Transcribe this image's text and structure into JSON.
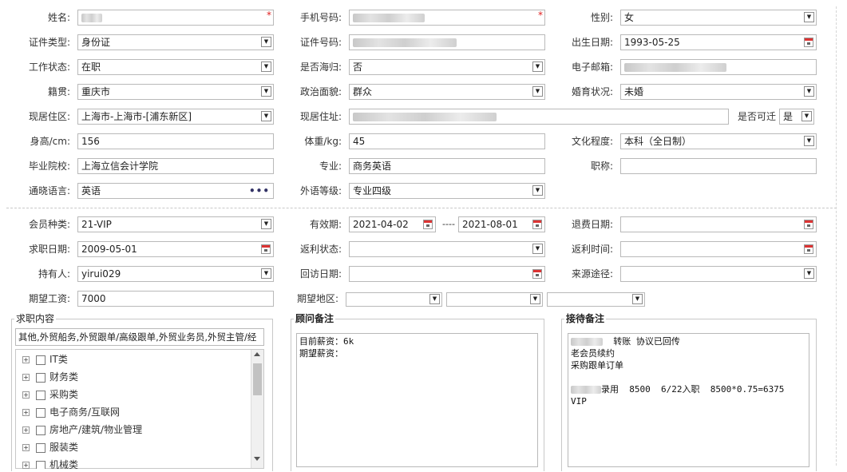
{
  "form": {
    "name": {
      "label": "姓名:"
    },
    "phone": {
      "label": "手机号码:"
    },
    "gender": {
      "label": "性别:",
      "value": "女"
    },
    "id_type": {
      "label": "证件类型:",
      "value": "身份证"
    },
    "id_number": {
      "label": "证件号码:"
    },
    "birth_date": {
      "label": "出生日期:",
      "value": "1993-05-25"
    },
    "work_status": {
      "label": "工作状态:",
      "value": "在职"
    },
    "returnee": {
      "label": "是否海归:",
      "value": "否"
    },
    "email": {
      "label": "电子邮箱:"
    },
    "native_place": {
      "label": "籍贯:",
      "value": "重庆市"
    },
    "political": {
      "label": "政治面貌:",
      "value": "群众"
    },
    "marital": {
      "label": "婚育状况:",
      "value": "未婚"
    },
    "current_area": {
      "label": "现居住区:",
      "value": "上海市-上海市-[浦东新区]"
    },
    "current_address": {
      "label": "现居住址:"
    },
    "relocatable": {
      "label": "是否可迁",
      "value": "是"
    },
    "height": {
      "label": "身高/cm:",
      "value": "156"
    },
    "weight": {
      "label": "体重/kg:",
      "value": "45"
    },
    "education": {
      "label": "文化程度:",
      "value": "本科（全日制）"
    },
    "school": {
      "label": "毕业院校:",
      "value": "上海立信会计学院"
    },
    "major": {
      "label": "专业:",
      "value": "商务英语"
    },
    "title": {
      "label": "职称:",
      "value": ""
    },
    "language": {
      "label": "通晓语言:",
      "value": "英语",
      "more": "•••"
    },
    "language_level": {
      "label": "外语等级:",
      "value": "专业四级"
    }
  },
  "membership": {
    "member_type": {
      "label": "会员种类:",
      "value": "21-VIP"
    },
    "valid_period": {
      "label": "有效期:",
      "from": "2021-04-02",
      "sep": "----",
      "to": "2021-08-01"
    },
    "refund_date": {
      "label": "退费日期:",
      "value": ""
    },
    "job_date": {
      "label": "求职日期:",
      "value": "2009-05-01"
    },
    "rebate_status": {
      "label": "返利状态:",
      "value": ""
    },
    "rebate_time": {
      "label": "返利时间:",
      "value": ""
    },
    "holder": {
      "label": "持有人:",
      "value": "yirui029"
    },
    "visit_date": {
      "label": "回访日期:",
      "value": ""
    },
    "source": {
      "label": "来源途径:",
      "value": ""
    },
    "expected_salary": {
      "label": "期望工资:",
      "value": "7000"
    },
    "expected_area": {
      "label": "期望地区:"
    }
  },
  "job_content": {
    "title": "求职内容",
    "summary": "其他,外贸船务,外贸跟单/高级跟单,外贸业务员,外贸主管/经",
    "tree": [
      {
        "label": "IT类"
      },
      {
        "label": "财务类"
      },
      {
        "label": "采购类"
      },
      {
        "label": "电子商务/互联网"
      },
      {
        "label": "房地产/建筑/物业管理"
      },
      {
        "label": "服装类"
      },
      {
        "label": "机械类"
      }
    ]
  },
  "consultant_notes": {
    "title": "顾问备注",
    "text": "目前薪资：6k\n期望薪资："
  },
  "reception_notes": {
    "title": "接待备注",
    "line1_suffix": "  转账 协议已回传",
    "line2": "老会员续约",
    "line3": "采购跟单订单",
    "line5_suffix": "录用  8500  6/22入职  8500*0.75=6375",
    "line6": "VIP"
  },
  "icons": {
    "dropdown": "▼",
    "tree_expand": "+"
  },
  "colors": {
    "required": "#e02020",
    "border": "#b9b9b9"
  }
}
